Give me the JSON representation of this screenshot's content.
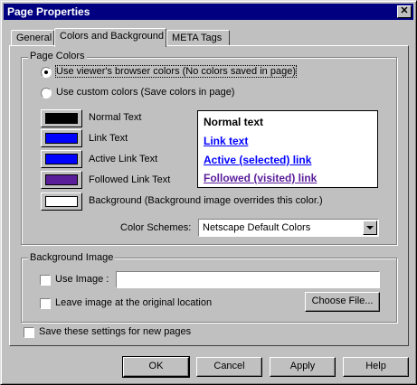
{
  "window": {
    "title": "Page Properties",
    "close_glyph": "✕"
  },
  "tabs": [
    {
      "label": "General",
      "active": false
    },
    {
      "label": "Colors and Background",
      "active": true
    },
    {
      "label": "META Tags",
      "active": false
    }
  ],
  "page_colors": {
    "group_label": "Page Colors",
    "radio_viewer": {
      "label": "Use viewer's browser colors (No colors saved in page)",
      "selected": true
    },
    "radio_custom": {
      "label": "Use custom colors (Save colors in page)",
      "selected": false
    },
    "swatches": [
      {
        "label": "Normal Text",
        "color": "#000000"
      },
      {
        "label": "Link Text",
        "color": "#0000ff"
      },
      {
        "label": "Active Link Text",
        "color": "#0000ff"
      },
      {
        "label": "Followed Link Text",
        "color": "#5a1e9b"
      },
      {
        "label": "Background (Background image overrides this color.)",
        "color": "#ffffff"
      }
    ],
    "preview": {
      "normal": "Normal text",
      "link": "Link text",
      "active": "Active (selected) link",
      "followed": "Followed (visited) link",
      "normal_color": "#000000",
      "link_color": "#0000ff",
      "followed_color": "#5a1e9b"
    },
    "color_schemes_label": "Color Schemes:",
    "color_schemes_value": "Netscape Default Colors"
  },
  "background_image": {
    "group_label": "Background Image",
    "use_image_label": "Use Image :",
    "use_image_checked": false,
    "use_image_value": "",
    "leave_original_label": "Leave image at the original location",
    "leave_original_checked": false,
    "choose_file_label": "Choose File..."
  },
  "save_settings": {
    "label": "Save these settings for new pages",
    "checked": false
  },
  "buttons": {
    "ok": "OK",
    "cancel": "Cancel",
    "apply": "Apply",
    "help": "Help"
  }
}
